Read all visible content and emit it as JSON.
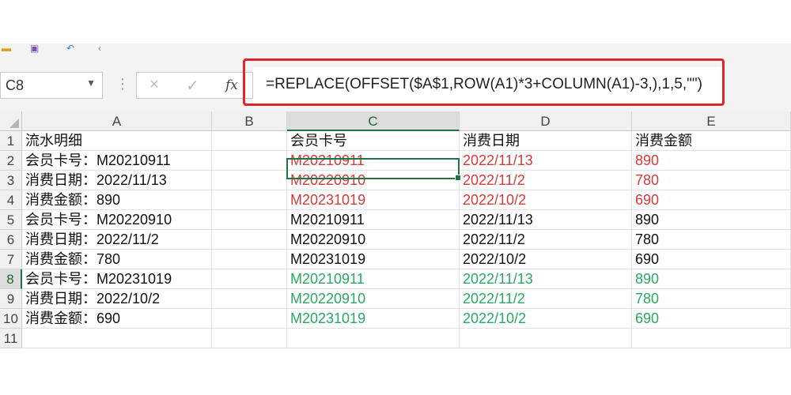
{
  "name_box": {
    "value": "C8"
  },
  "formula_bar": {
    "cancel_icon": "×",
    "confirm_icon": "✓",
    "fx_label": "fx",
    "formula": "=REPLACE(OFFSET($A$1,ROW(A1)*3+COLUMN(A1)-3,),1,5,\"\")"
  },
  "columns": [
    "A",
    "B",
    "C",
    "D",
    "E"
  ],
  "active_column": "C",
  "row_numbers": [
    "1",
    "2",
    "3",
    "4",
    "5",
    "6",
    "7",
    "8",
    "9",
    "10",
    "11"
  ],
  "active_row": "8",
  "cells": {
    "r1": {
      "A": "流水明细",
      "B": "",
      "C": "会员卡号",
      "D": "消费日期",
      "E": "消费金额"
    },
    "r2": {
      "A": "会员卡号：M20210911",
      "B": "",
      "C": "M20210911",
      "D": "2022/11/13",
      "E": "890"
    },
    "r3": {
      "A": "消费日期：2022/11/13",
      "B": "",
      "C": "M20220910",
      "D": "2022/11/2",
      "E": "780"
    },
    "r4": {
      "A": "消费金额：890",
      "B": "",
      "C": "M20231019",
      "D": "2022/10/2",
      "E": "690"
    },
    "r5": {
      "A": "会员卡号：M20220910",
      "B": "",
      "C": "M20210911",
      "D": "2022/11/13",
      "E": "890"
    },
    "r6": {
      "A": "消费日期：2022/11/2",
      "B": "",
      "C": "M20220910",
      "D": "2022/11/2",
      "E": "780"
    },
    "r7": {
      "A": "消费金额：780",
      "B": "",
      "C": "M20231019",
      "D": "2022/10/2",
      "E": "690"
    },
    "r8": {
      "A": "会员卡号：M20231019",
      "B": "",
      "C": "M20210911",
      "D": "2022/11/13",
      "E": "890"
    },
    "r9": {
      "A": "消费日期：2022/10/2",
      "B": "",
      "C": "M20220910",
      "D": "2022/11/2",
      "E": "780"
    },
    "r10": {
      "A": "消费金额：690",
      "B": "",
      "C": "M20231019",
      "D": "2022/10/2",
      "E": "690"
    },
    "r11": {
      "A": "",
      "B": "",
      "C": "",
      "D": "",
      "E": ""
    }
  },
  "colors": {
    "highlight_border": "#e0262b",
    "red_text": "#d63a3a",
    "green_text": "#2aa862",
    "selection": "#217346"
  }
}
